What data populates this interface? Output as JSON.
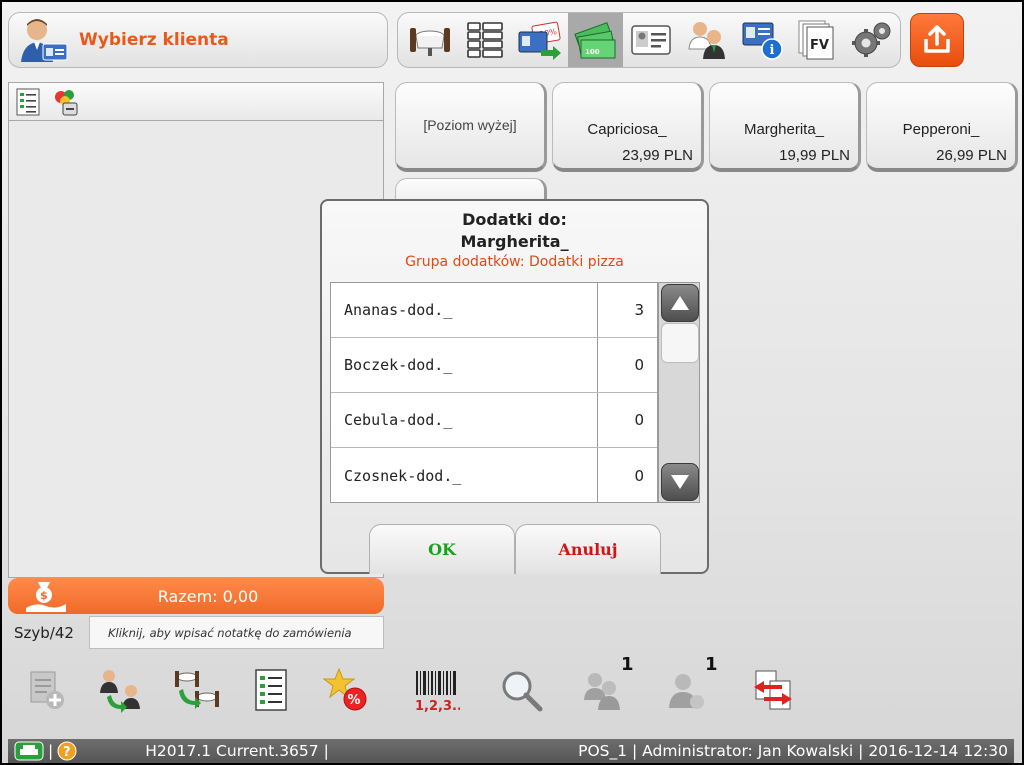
{
  "client": {
    "label": "Wybierz klienta"
  },
  "toolbar": {
    "icons": [
      "tables-icon",
      "grid-icon",
      "discount-card-icon",
      "cash-icon",
      "id-card-icon",
      "users-icon",
      "info-card-icon",
      "invoice-icon",
      "settings-icon"
    ],
    "invoice_label": "FV",
    "active_index": 3
  },
  "products": [
    {
      "name": "[Poziom wyżej]",
      "price": ""
    },
    {
      "name": "Capriciosa_",
      "price": "23,99 PLN"
    },
    {
      "name": "Margherita_",
      "price": "19,99 PLN"
    },
    {
      "name": "Pepperoni_",
      "price": "26,99 PLN"
    }
  ],
  "dialog": {
    "title_line1": "Dodatki do:",
    "title_line2": "Margherita_",
    "group": "Grupa dodatków: Dodatki pizza",
    "items": [
      {
        "name": "Ananas-dod._",
        "qty": "3"
      },
      {
        "name": "Boczek-dod._",
        "qty": "0"
      },
      {
        "name": "Cebula-dod._",
        "qty": "0"
      },
      {
        "name": "Czosnek-dod._",
        "qty": "0"
      }
    ],
    "ok_label": "OK",
    "cancel_label": "Anuluj",
    "ok_color": "#1aa01a",
    "cancel_color": "#d21414"
  },
  "order": {
    "total": "Razem: 0,00",
    "table": "Szyb/42",
    "note_placeholder": "Kliknij, aby wpisać notatkę do zamówienia"
  },
  "bottom_toolbar": {
    "barcode_label": "1,2,3...",
    "badge1": "1",
    "badge2": "1"
  },
  "status": {
    "version": "H2017.1 Current.3657 |",
    "session": "POS_1 | Administrator: Jan Kowalski | 2016-12-14 12:30"
  },
  "colors": {
    "accent": "#e85a19",
    "total_bar": "#f06a28"
  }
}
